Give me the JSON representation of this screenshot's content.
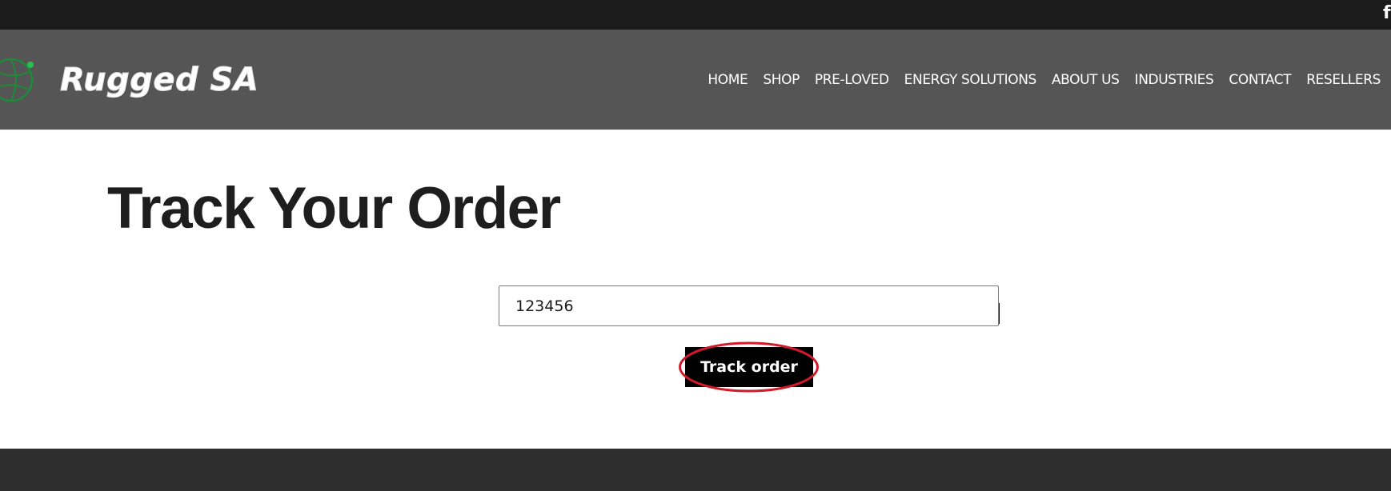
{
  "topbar": {
    "social_icon": "facebook-icon",
    "social_glyph": "f"
  },
  "header": {
    "brand_name": "Rugged SA",
    "logo_icon": "globe-logo-icon",
    "nav": {
      "items": [
        {
          "label": "HOME"
        },
        {
          "label": "SHOP"
        },
        {
          "label": "PRE-LOVED"
        },
        {
          "label": "ENERGY SOLUTIONS"
        },
        {
          "label": "ABOUT US"
        },
        {
          "label": "INDUSTRIES"
        },
        {
          "label": "CONTACT"
        },
        {
          "label": "RESELLERS"
        }
      ]
    }
  },
  "main": {
    "title": "Track Your Order",
    "order_input": {
      "value": "123456"
    },
    "track_button": {
      "label": "Track order"
    }
  },
  "colors": {
    "topbar": "#1b1b1b",
    "header": "#555555",
    "footer": "#2e2e2e",
    "logo_accent": "#1f8a3a",
    "highlight": "#d11a2a"
  }
}
